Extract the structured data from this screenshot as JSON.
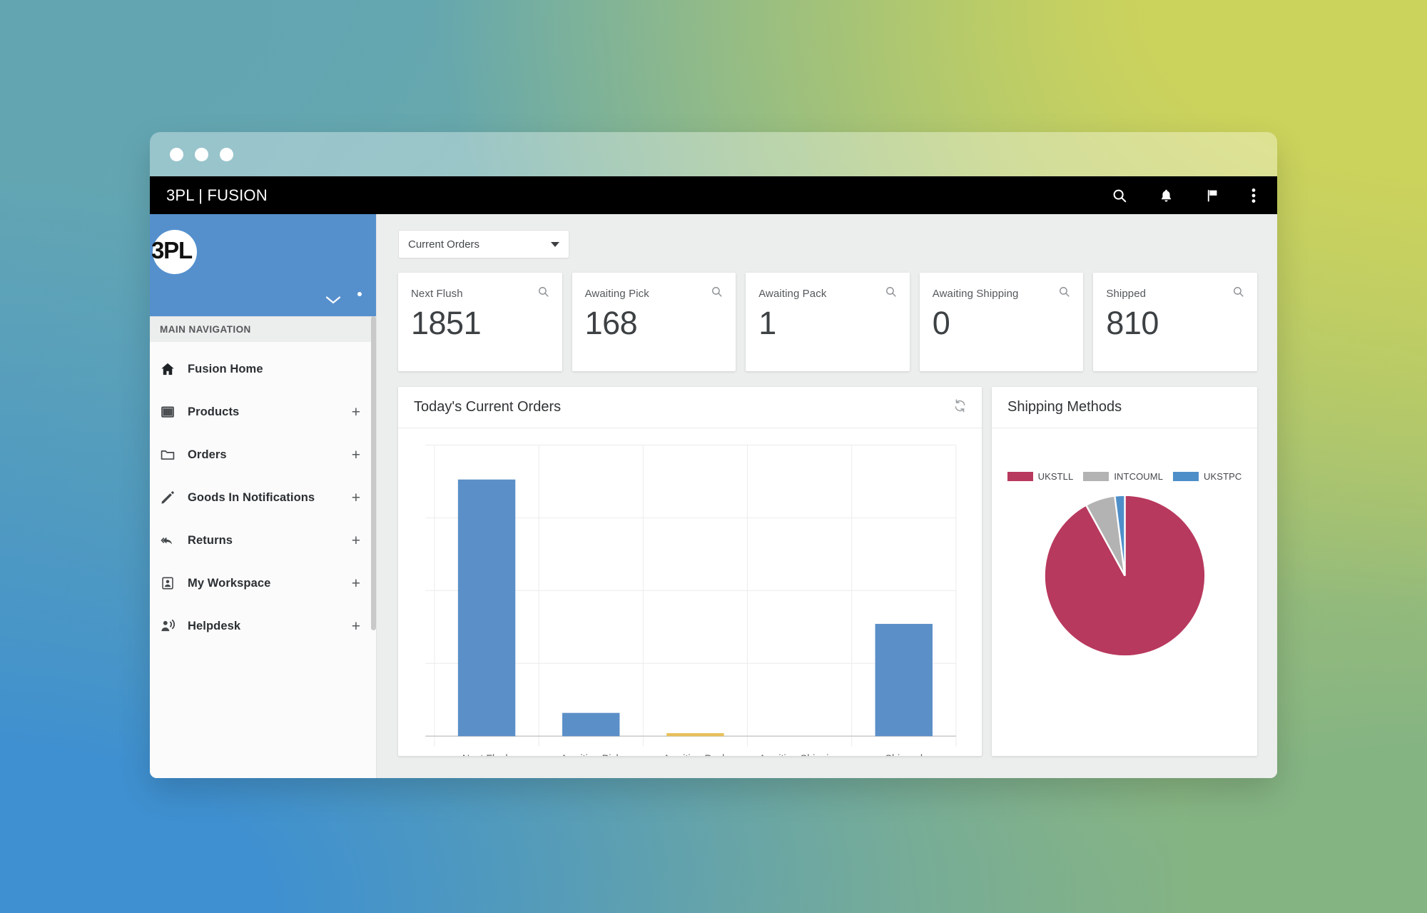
{
  "window": {
    "dots": [
      "close",
      "minimize",
      "maximize"
    ]
  },
  "topbar": {
    "brand": "3PL | FUSION",
    "icons": [
      {
        "name": "search-icon",
        "label": "Search"
      },
      {
        "name": "bell-icon",
        "label": "Notifications"
      },
      {
        "name": "flag-icon",
        "label": "Flags"
      },
      {
        "name": "more-vertical-icon",
        "label": "More options"
      }
    ]
  },
  "sidebar": {
    "logo_text": "3PL",
    "header_color": "#5590cd",
    "collapse_icon": "chevron-down-icon",
    "nav_title": "MAIN NAVIGATION",
    "items": [
      {
        "label": "Fusion Home",
        "icon": "home-icon",
        "expandable": false,
        "expand_glyph": ""
      },
      {
        "label": "Products",
        "icon": "grid-icon",
        "expandable": true,
        "expand_glyph": "+"
      },
      {
        "label": "Orders",
        "icon": "folder-icon",
        "expandable": true,
        "expand_glyph": "+"
      },
      {
        "label": "Goods In Notifications",
        "icon": "pencil-icon",
        "expandable": true,
        "expand_glyph": "+"
      },
      {
        "label": "Returns",
        "icon": "reply-all-icon",
        "expandable": true,
        "expand_glyph": "+"
      },
      {
        "label": "My Workspace",
        "icon": "person-icon",
        "expandable": true,
        "expand_glyph": "+"
      },
      {
        "label": "Helpdesk",
        "icon": "support-icon",
        "expandable": true,
        "expand_glyph": "+"
      }
    ]
  },
  "main": {
    "filter": {
      "selected": "Current Orders",
      "caret_icon": "chevron-down-icon"
    },
    "kpis": [
      {
        "title": "Next Flush",
        "value": "1851",
        "icon": "search-icon"
      },
      {
        "title": "Awaiting Pick",
        "value": "168",
        "icon": "search-icon"
      },
      {
        "title": "Awaiting Pack",
        "value": "1",
        "icon": "search-icon"
      },
      {
        "title": "Awaiting Shipping",
        "value": "0",
        "icon": "search-icon"
      },
      {
        "title": "Shipped",
        "value": "810",
        "icon": "search-icon"
      }
    ],
    "orders_panel": {
      "title": "Today's Current Orders",
      "refresh_icon": "refresh-icon"
    },
    "shipping_panel": {
      "title": "Shipping Methods"
    }
  },
  "chart_data": [
    {
      "type": "bar",
      "title": "Today's Current Orders",
      "categories": [
        "Next Flush",
        "Awaiting Pick",
        "Awaiting Pack",
        "Awaiting Shipping",
        "Shipped"
      ],
      "values": [
        1851,
        168,
        1,
        0,
        810
      ],
      "colors": [
        "#5b8fc7",
        "#5b8fc7",
        "#e8c05a",
        "#5b8fc7",
        "#5b8fc7"
      ],
      "xlabel": "",
      "ylabel": "",
      "ylim": [
        0,
        2100
      ],
      "grid": true,
      "legend": "none"
    },
    {
      "type": "pie",
      "title": "Shipping Methods",
      "labels": [
        "UKSTLL",
        "INTCOUML",
        "UKSTPC"
      ],
      "values": [
        92,
        6,
        2
      ],
      "colors": [
        "#b8395e",
        "#b3b3b3",
        "#4e8fc9"
      ],
      "legend": "top"
    }
  ]
}
